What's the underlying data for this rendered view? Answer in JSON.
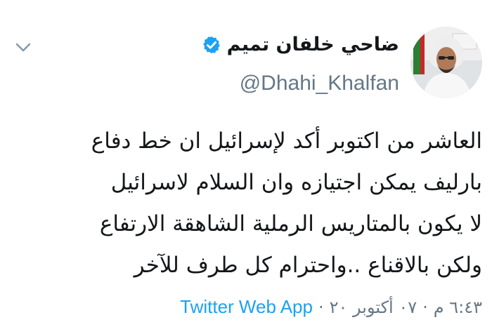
{
  "tweet": {
    "author": {
      "display_name": "ضاحي خلفان تميم",
      "handle": "@Dhahi_Khalfan",
      "verified": true,
      "verified_icon": "verified-badge-icon"
    },
    "text_lines": [
      "العاشر من اكتوبر أكد لإسرائيل ان خط دفاع",
      "بارليف يمكن اجتيازه وان السلام لاسرائيل",
      "لا يكون بالمتاريس الرملية الشاهقة الارتفاع",
      "ولكن بالاقناع ..واحترام كل طرف للآخر"
    ],
    "time": "٦:٤٣ م",
    "date": "٠٧ أكتوبر ٢٠",
    "separator": "·",
    "source": "Twitter Web App",
    "menu_icon": "chevron-down-icon"
  },
  "colors": {
    "text": "#14171a",
    "secondary": "#657786",
    "link": "#1da1f2",
    "verified": "#1da1f2"
  }
}
